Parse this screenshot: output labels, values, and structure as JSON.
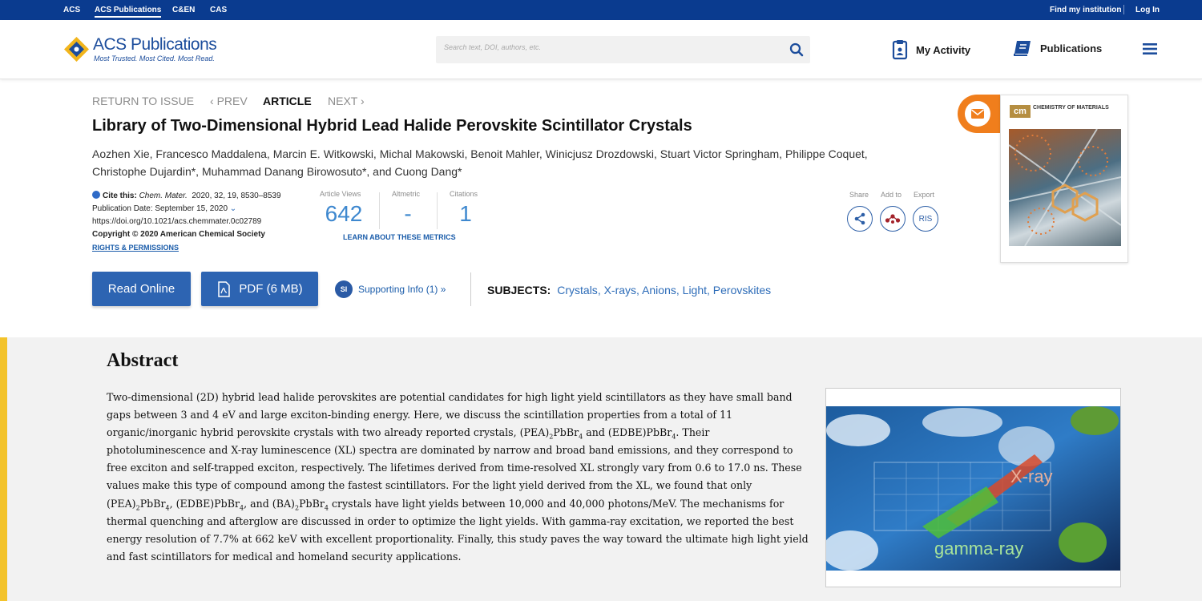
{
  "topbar": {
    "links": [
      "ACS",
      "ACS Publications",
      "C&EN",
      "CAS"
    ],
    "find_institution": "Find my institution",
    "login": "Log In"
  },
  "header": {
    "logo_text": "ACS Publications",
    "logo_tagline": "Most Trusted. Most Cited. Most Read.",
    "search_placeholder": "Search text, DOI, authors, etc.",
    "my_activity": "My Activity",
    "publications": "Publications"
  },
  "article_nav": {
    "return": "RETURN TO ISSUE",
    "prev": "PREV",
    "current": "ARTICLE",
    "next": "NEXT"
  },
  "article": {
    "title": "Library of Two-Dimensional Hybrid Lead Halide Perovskite Scintillator Crystals",
    "authors": "Aozhen Xie, Francesco Maddalena, Marcin E. Witkowski, Michal Makowski, Benoit Mahler, Winicjusz Drozdowski, Stuart Victor Springham, Philippe Coquet, Christophe Dujardin*, Muhammad Danang Birowosuto*, and Cuong Dang*",
    "cite_label": "Cite this:",
    "journal": "Chem. Mater.",
    "citation": "2020, 32, 19, 8530–8539",
    "pub_date": "Publication Date: September 15, 2020",
    "doi": "https://doi.org/10.1021/acs.chemmater.0c02789",
    "copyright": "Copyright © 2020 American Chemical Society",
    "rights": "RIGHTS & PERMISSIONS"
  },
  "metrics": {
    "views_label": "Article Views",
    "views": "642",
    "altmetric_label": "Altmetric",
    "altmetric": "-",
    "citations_label": "Citations",
    "citations": "1",
    "learn": "LEARN ABOUT THESE METRICS"
  },
  "tools": {
    "share": "Share",
    "add_to": "Add to",
    "export": "Export",
    "ris": "RIS"
  },
  "cover": {
    "badge": "cm",
    "journal_name": "CHEMISTRY OF MATERIALS"
  },
  "actions": {
    "read_online": "Read Online",
    "pdf": "PDF (6 MB)",
    "si_badge": "SI",
    "supporting_info": "Supporting Info (1) »",
    "subjects_label": "SUBJECTS:",
    "subjects": [
      "Crystals",
      "X-rays",
      "Anions",
      "Light",
      "Perovskites"
    ]
  },
  "abstract": {
    "heading": "Abstract",
    "p1": "Two-dimensional (2D) hybrid lead halide perovskites are potential candidates for high light yield scintillators as they have small band gaps between 3 and 4 eV and large exciton-binding energy. Here, we discuss the scintillation properties from a total of 11 organic/inorganic hybrid perovskite crystals with two already reported crystals, ",
    "f1a": "(PEA)",
    "f1s1": "2",
    "f1b": "PbBr",
    "f1s2": "4",
    "and1": " and ",
    "f2a": "(EDBE)PbBr",
    "f2s": "4",
    "p2": ". Their photoluminescence and X-ray luminescence (XL) spectra are dominated by narrow and broad band emissions, and they correspond to free exciton and self-trapped exciton, respectively. The lifetimes derived from time-resolved XL strongly vary from 0.6 to 17.0 ns. These values make this type of compound among the fastest scintillators. For the light yield derived from the XL, we found that only ",
    "g1a": "(PEA)",
    "g1s1": "2",
    "g1b": "PbBr",
    "g1s2": "4",
    "c1": ", ",
    "g2a": "(EDBE)PbBr",
    "g2s": "4",
    "c2": ", and ",
    "g3a": "(BA)",
    "g3s1": "2",
    "g3b": "PbBr",
    "g3s2": "4",
    "p3": " crystals have light yields between 10,000 and 40,000 photons/MeV. The mechanisms for thermal quenching and afterglow are discussed in order to optimize the light yields. With gamma-ray excitation, we reported the best energy resolution of 7.7% at 662 keV with excellent proportionality. Finally, this study paves the way toward the ultimate high light yield and fast scintillators for medical and homeland security applications.",
    "toc_label_xray": "X-ray",
    "toc_label_gamma": "gamma-ray"
  }
}
